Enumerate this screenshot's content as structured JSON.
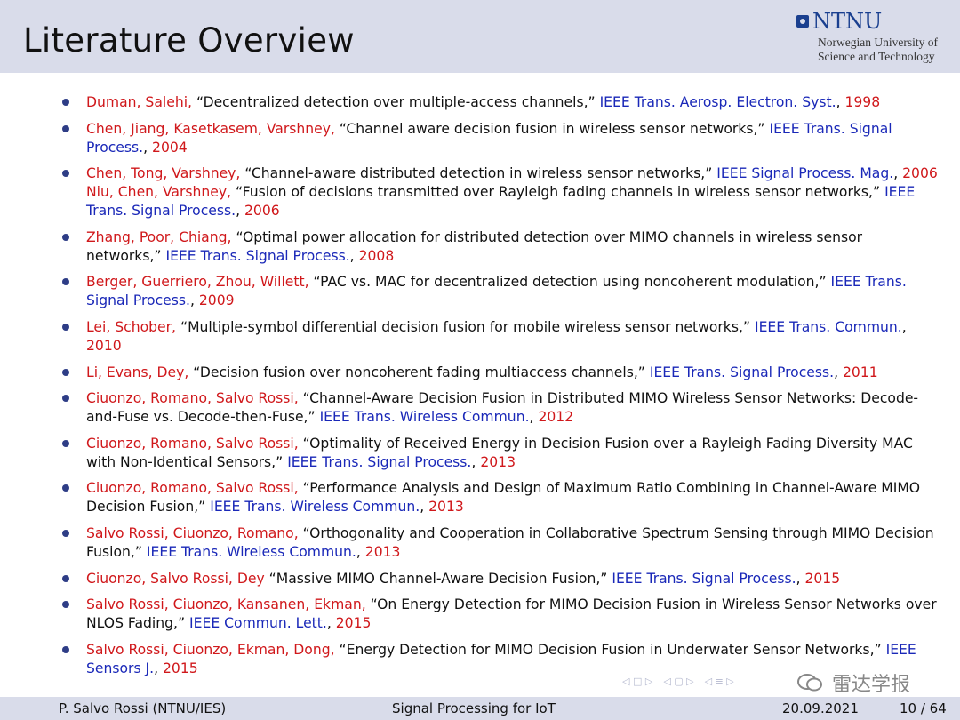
{
  "header": {
    "title": "Literature Overview",
    "logo_name": "NTNU",
    "logo_line1": "Norwegian University of",
    "logo_line2": "Science and Technology"
  },
  "references": [
    {
      "authors": "Duman, Salehi,",
      "title": "“Decentralized detection over multiple-access channels,”",
      "venue": "IEEE Trans. Aerosp. Electron. Syst.",
      "year": "1998"
    },
    {
      "authors": "Chen, Jiang, Kasetkasem, Varshney,",
      "title": "“Channel aware decision fusion in wireless sensor networks,”",
      "venue": "IEEE Trans. Signal Process.",
      "year": "2004"
    },
    {
      "authors": "Chen, Tong, Varshney,",
      "title": "“Channel-aware distributed detection in wireless sensor networks,”",
      "venue": "IEEE Signal Process. Mag.",
      "year": "2006 Niu, Chen, Varshney,",
      "extra_title": "“Fusion of decisions transmitted over Rayleigh fading channels in wireless sensor networks,”",
      "extra_venue": "IEEE Trans. Signal Process.",
      "extra_year": "2006"
    },
    {
      "authors": "Zhang, Poor, Chiang,",
      "title": "“Optimal power allocation for distributed detection over MIMO channels in wireless sensor networks,”",
      "venue": "IEEE Trans. Signal Process.",
      "year": "2008"
    },
    {
      "authors": "Berger, Guerriero, Zhou, Willett,",
      "title": "“PAC vs. MAC for decentralized detection using noncoherent modulation,”",
      "venue": "IEEE Trans. Signal Process.",
      "year": "2009"
    },
    {
      "authors": "Lei, Schober,",
      "title": "“Multiple-symbol differential decision fusion for mobile wireless sensor networks,”",
      "venue": "IEEE Trans. Commun.",
      "year": "2010"
    },
    {
      "authors": "Li, Evans, Dey,",
      "title": "“Decision fusion over noncoherent fading multiaccess channels,”",
      "venue": "IEEE Trans. Signal Process.",
      "year": "2011"
    },
    {
      "authors": "Ciuonzo, Romano, Salvo Rossi,",
      "title": "“Channel-Aware Decision Fusion in Distributed MIMO Wireless Sensor Networks: Decode-and-Fuse vs. Decode-then-Fuse,”",
      "venue": "IEEE Trans. Wireless Commun.",
      "year": "2012"
    },
    {
      "authors": "Ciuonzo, Romano, Salvo Rossi,",
      "title": "“Optimality of Received Energy in Decision Fusion over a Rayleigh Fading Diversity MAC with Non-Identical Sensors,”",
      "venue": "IEEE Trans. Signal Process.",
      "year": "2013"
    },
    {
      "authors": "Ciuonzo, Romano, Salvo Rossi,",
      "title": "“Performance Analysis and Design of Maximum Ratio Combining in Channel-Aware MIMO Decision Fusion,”",
      "venue": "IEEE Trans. Wireless Commun.",
      "year": "2013"
    },
    {
      "authors": "Salvo Rossi, Ciuonzo, Romano,",
      "title": "“Orthogonality and Cooperation in Collaborative Spectrum Sensing through MIMO Decision Fusion,”",
      "venue": "IEEE Trans. Wireless Commun.",
      "year": "2013"
    },
    {
      "authors": "Ciuonzo, Salvo Rossi, Dey",
      "title": "“Massive MIMO Channel-Aware Decision Fusion,”",
      "venue": "IEEE Trans. Signal Process.",
      "year": "2015"
    },
    {
      "authors": "Salvo Rossi, Ciuonzo, Kansanen, Ekman,",
      "title": "“On Energy Detection for MIMO Decision Fusion in Wireless Sensor Networks over NLOS Fading,”",
      "venue": "IEEE Commun. Lett.",
      "year": "2015"
    },
    {
      "authors": "Salvo Rossi, Ciuonzo, Ekman, Dong,",
      "title": "“Energy Detection for MIMO Decision Fusion in Underwater Sensor Networks,”",
      "venue": "IEEE Sensors J.",
      "year": "2015"
    }
  ],
  "watermark": "雷达学报",
  "footer": {
    "author": "P. Salvo Rossi  (NTNU/IES)",
    "course": "Signal Processing for IoT",
    "date": "20.09.2021",
    "page": "10 / 64"
  }
}
